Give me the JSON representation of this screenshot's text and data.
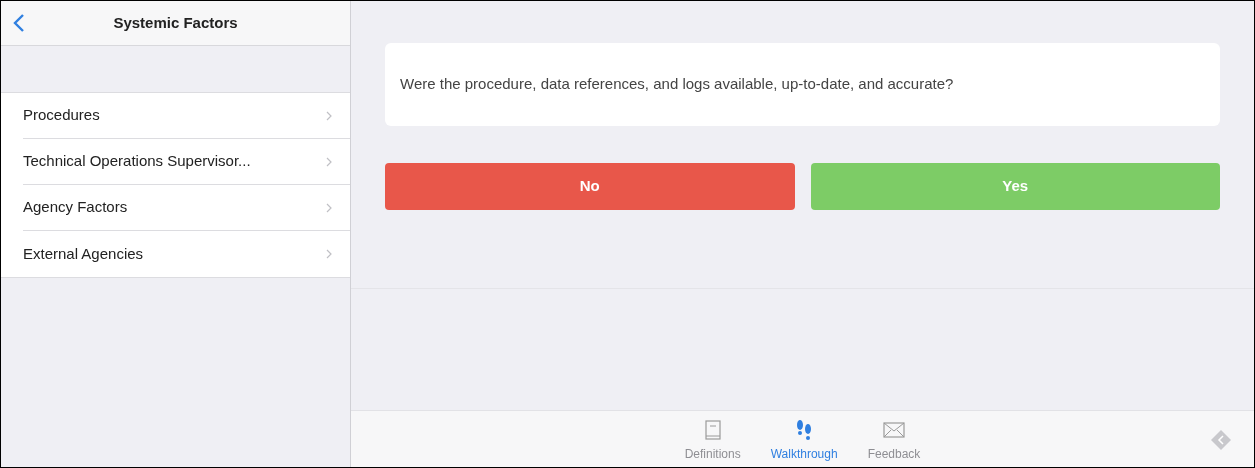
{
  "sidebar": {
    "title": "Systemic Factors",
    "items": [
      {
        "label": "Procedures"
      },
      {
        "label": "Technical Operations Supervisor..."
      },
      {
        "label": "Agency Factors"
      },
      {
        "label": "External Agencies"
      }
    ]
  },
  "question": "Were the procedure, data references, and logs available, up-to-date, and accurate?",
  "answers": [
    {
      "label": "No",
      "color": "#e8574a"
    },
    {
      "label": "Yes",
      "color": "#7dcc66"
    }
  ],
  "tab_bar": [
    {
      "label": "Definitions",
      "selected": false
    },
    {
      "label": "Walkthrough",
      "selected": true
    },
    {
      "label": "Feedback",
      "selected": false
    }
  ]
}
